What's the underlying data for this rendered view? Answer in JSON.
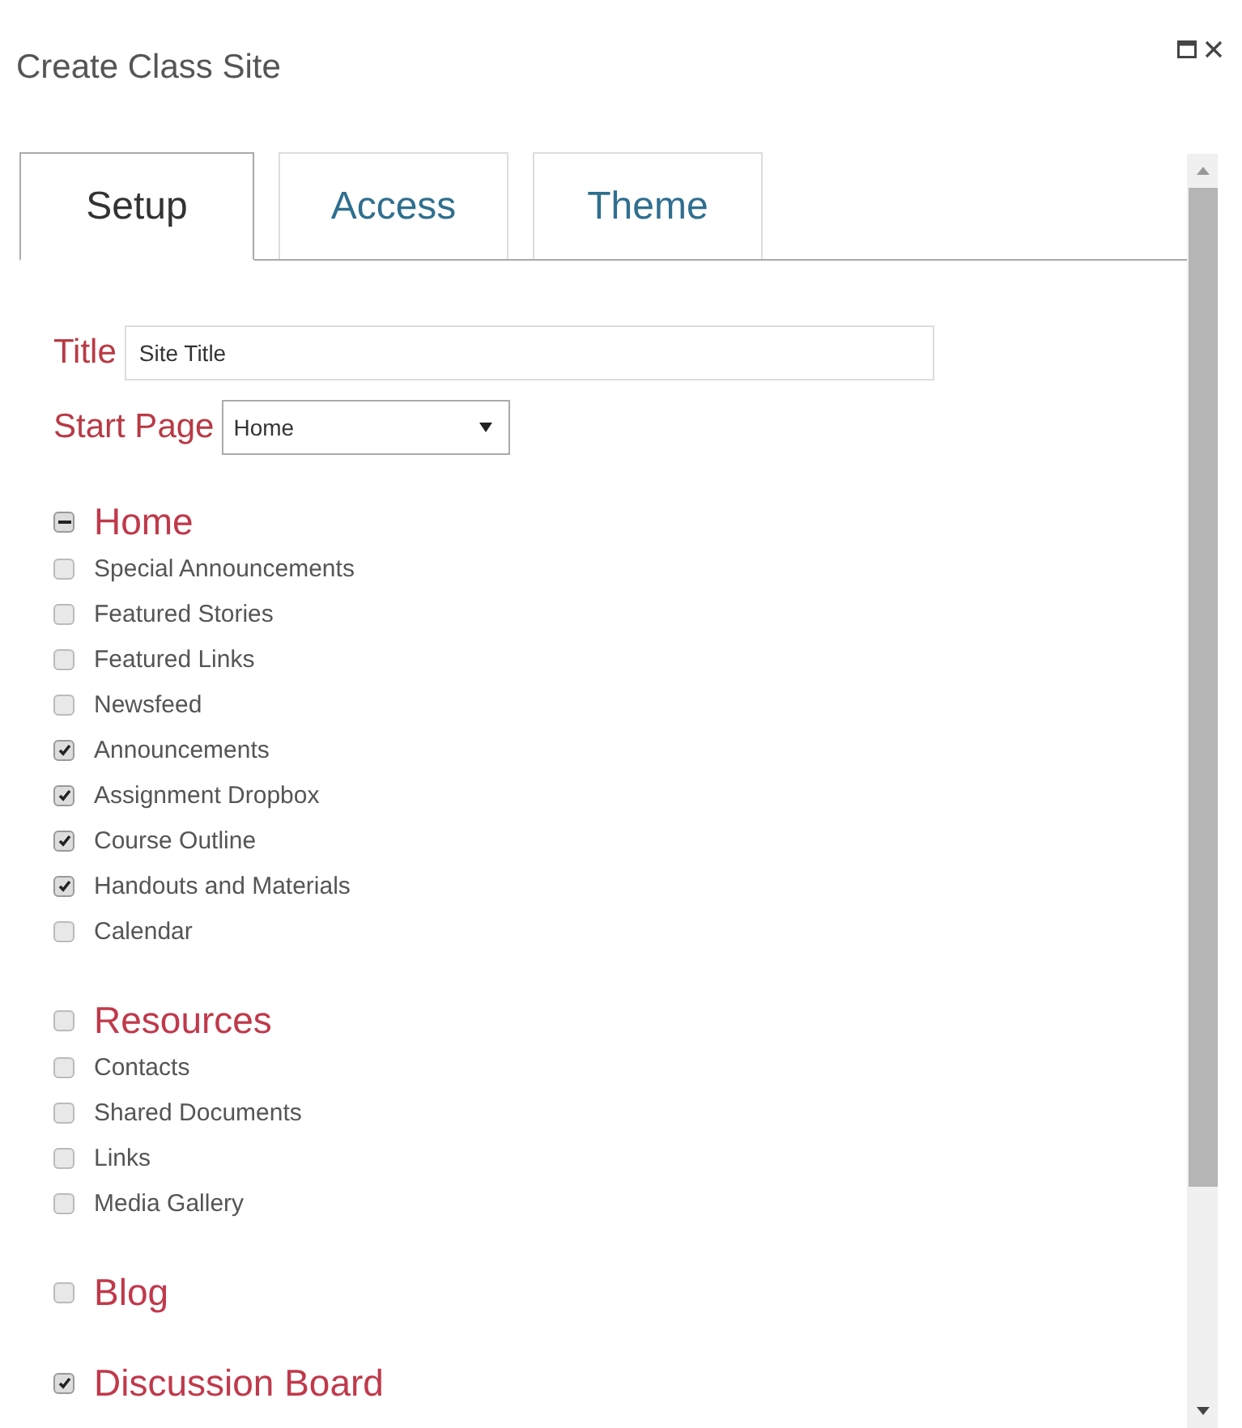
{
  "window": {
    "title": "Create Class Site"
  },
  "tabs": [
    {
      "label": "Setup",
      "selected": true
    },
    {
      "label": "Access",
      "selected": false
    },
    {
      "label": "Theme",
      "selected": false
    }
  ],
  "fields": {
    "title": {
      "label": "Title",
      "value": "Site Title"
    },
    "start_page": {
      "label": "Start Page",
      "value": "Home"
    }
  },
  "sections": [
    {
      "label": "Home",
      "checked": false,
      "mixed": true,
      "items": [
        {
          "label": "Special Announcements",
          "checked": false
        },
        {
          "label": "Featured Stories",
          "checked": false
        },
        {
          "label": "Featured Links",
          "checked": false
        },
        {
          "label": "Newsfeed",
          "checked": false
        },
        {
          "label": "Announcements",
          "checked": true
        },
        {
          "label": "Assignment Dropbox",
          "checked": true
        },
        {
          "label": "Course Outline",
          "checked": true
        },
        {
          "label": "Handouts and Materials",
          "checked": true
        },
        {
          "label": "Calendar",
          "checked": false
        }
      ]
    },
    {
      "label": "Resources",
      "checked": false,
      "mixed": false,
      "items": [
        {
          "label": "Contacts",
          "checked": false
        },
        {
          "label": "Shared Documents",
          "checked": false
        },
        {
          "label": "Links",
          "checked": false
        },
        {
          "label": "Media Gallery",
          "checked": false
        }
      ]
    },
    {
      "label": "Blog",
      "checked": false,
      "mixed": false
    },
    {
      "label": "Discussion Board",
      "checked": true,
      "mixed": false
    }
  ]
}
